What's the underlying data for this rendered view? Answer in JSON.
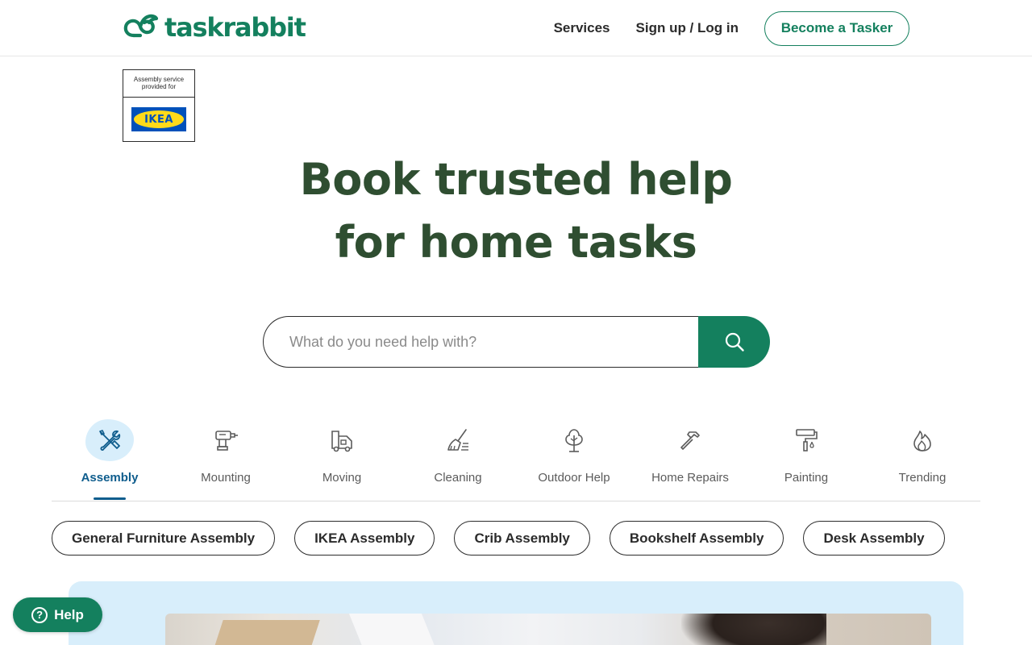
{
  "header": {
    "logo_text": "taskrabbit",
    "nav": {
      "services": "Services",
      "signup_login": "Sign up / Log in",
      "become_tasker": "Become a Tasker"
    }
  },
  "ikea_badge": {
    "caption_line1": "Assembly service",
    "caption_line2": "provided for",
    "logo_text": "IKEA"
  },
  "hero": {
    "title_line1": "Book trusted help",
    "title_line2": "for home tasks"
  },
  "search": {
    "placeholder": "What do you need help with?",
    "value": ""
  },
  "categories": [
    {
      "label": "Assembly",
      "icon": "tools-icon",
      "active": true
    },
    {
      "label": "Mounting",
      "icon": "drill-icon",
      "active": false
    },
    {
      "label": "Moving",
      "icon": "moving-truck-icon",
      "active": false
    },
    {
      "label": "Cleaning",
      "icon": "broom-icon",
      "active": false
    },
    {
      "label": "Outdoor Help",
      "icon": "tree-icon",
      "active": false
    },
    {
      "label": "Home Repairs",
      "icon": "hammer-icon",
      "active": false
    },
    {
      "label": "Painting",
      "icon": "paint-roller-icon",
      "active": false
    },
    {
      "label": "Trending",
      "icon": "flame-icon",
      "active": false
    }
  ],
  "chips": [
    "General Furniture Assembly",
    "IKEA Assembly",
    "Crib Assembly",
    "Bookshelf Assembly",
    "Desk Assembly"
  ],
  "help_button": {
    "label": "Help",
    "icon_glyph": "?"
  },
  "colors": {
    "brand_green": "#14805e",
    "hero_text": "#2f4e31",
    "active_blue": "#0f5d8d",
    "panel_blue": "#d8eefb",
    "ikea_blue": "#0051ba",
    "ikea_yellow": "#ffda1a"
  }
}
